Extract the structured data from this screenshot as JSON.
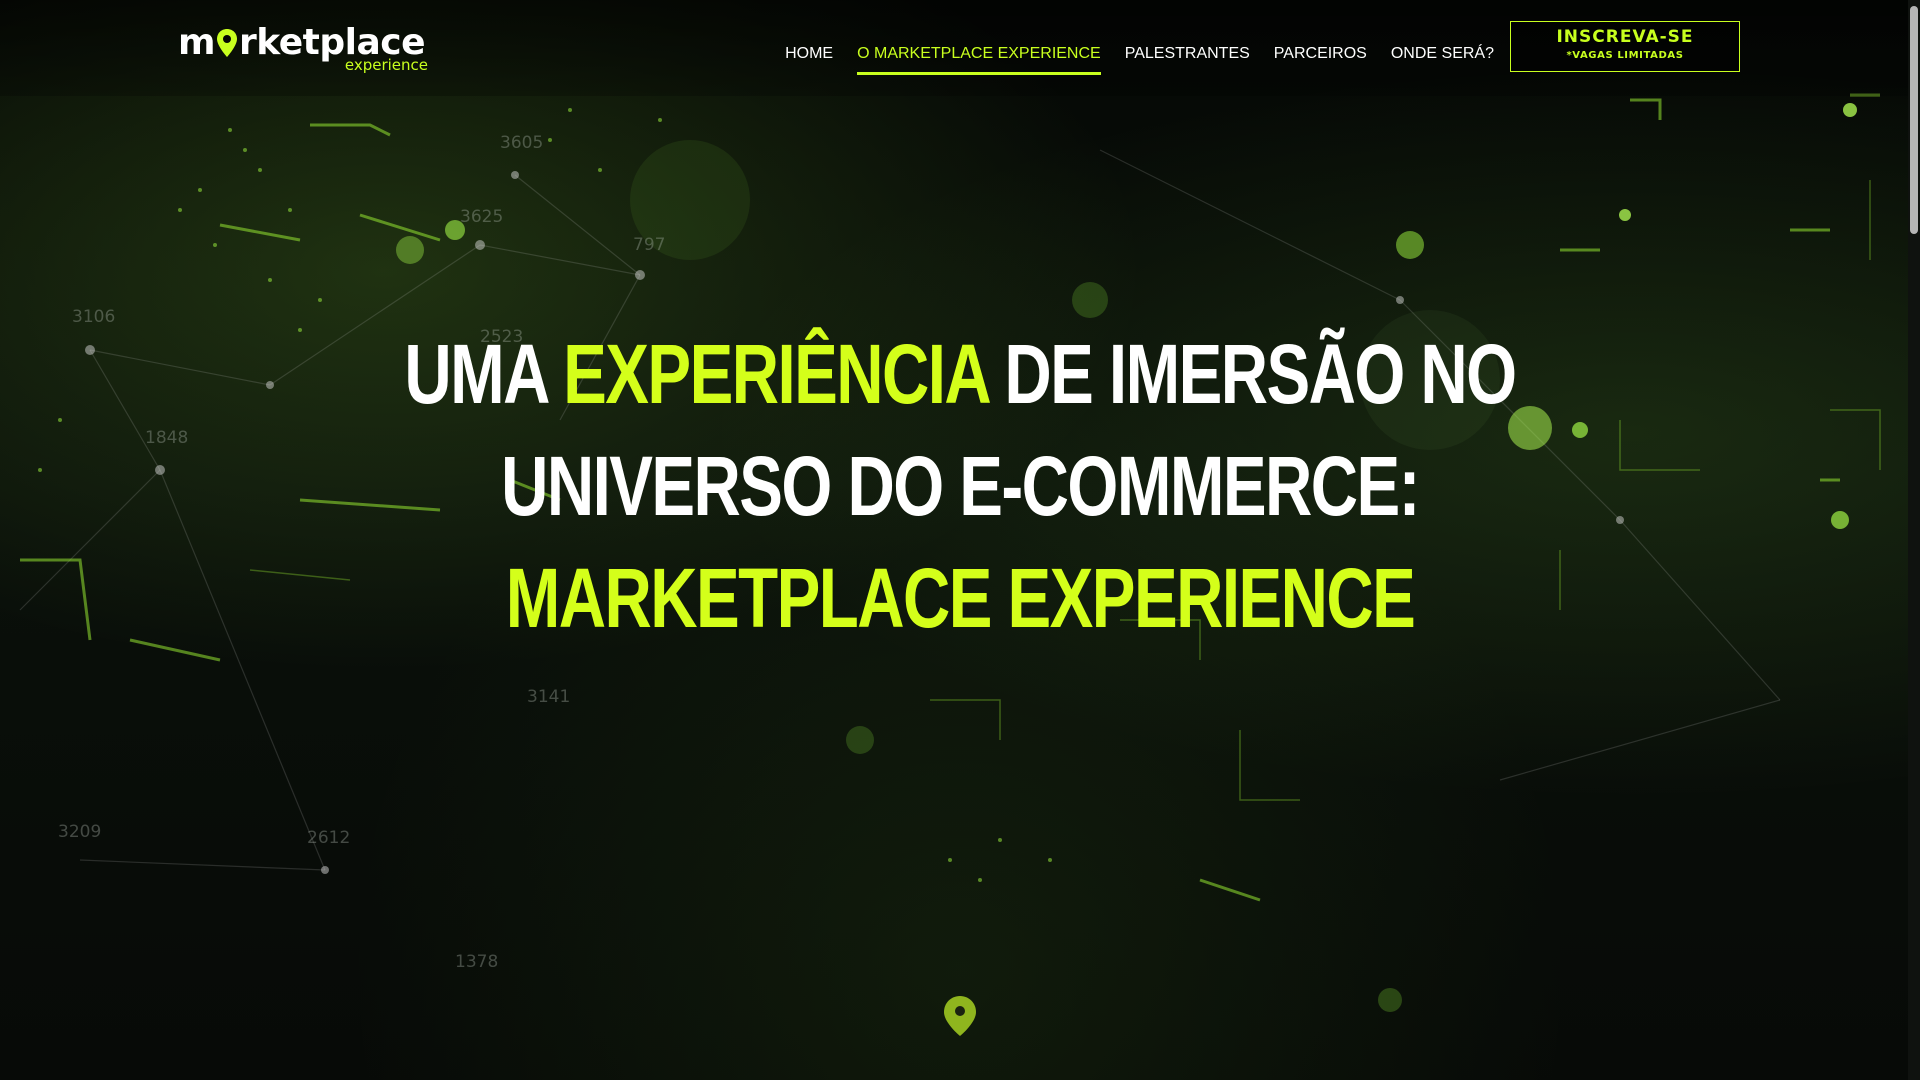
{
  "header": {
    "logo": {
      "word_start": "m",
      "word_end": "rketplace",
      "subtitle": "experience"
    },
    "nav": [
      {
        "label": "HOME",
        "active": false
      },
      {
        "label": "O MARKETPLACE EXPERIENCE",
        "active": true
      },
      {
        "label": "PALESTRANTES",
        "active": false
      },
      {
        "label": "PARCEIROS",
        "active": false
      },
      {
        "label": "ONDE SERÁ?",
        "active": false
      }
    ],
    "cta": {
      "label": "INSCREVA-SE",
      "sublabel": "*VAGAS LIMITADAS"
    }
  },
  "hero": {
    "line1_part1": "UMA ",
    "line1_accent": "EXPERIÊNCIA",
    "line1_part2": " DE IMERSÃO NO",
    "line2": "UNIVERSO DO E-COMMERCE:",
    "line3_accent": "MARKETPLACE EXPERIENCE"
  },
  "background": {
    "network_numbers": [
      "3605",
      "3625",
      "797",
      "3106",
      "2523",
      "1848",
      "3141",
      "3209",
      "2612",
      "1378"
    ]
  },
  "colors": {
    "accent": "#c8ff1e",
    "hero_accent": "#d4ff1a",
    "background": "#040604",
    "text": "#ffffff",
    "pin": "#8fb51e"
  },
  "icons": {
    "logo_pin": "location-pin-icon",
    "scroll_pin": "location-pin-icon"
  }
}
